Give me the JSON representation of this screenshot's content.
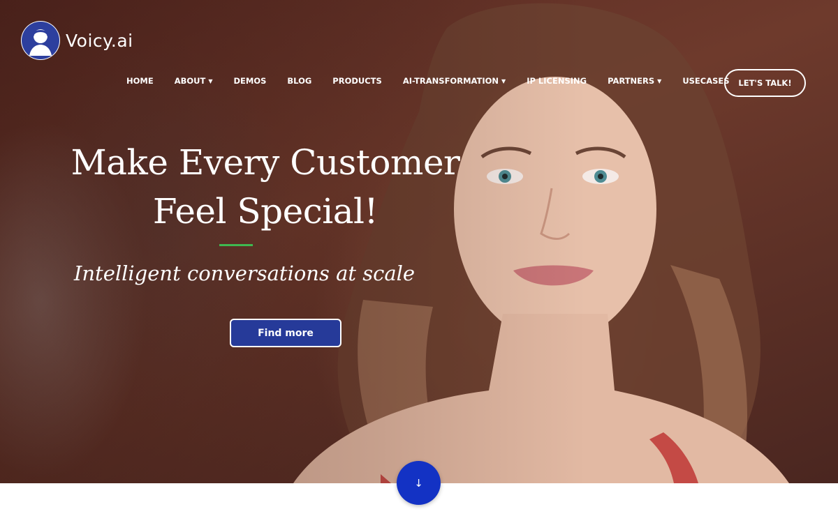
{
  "header": {
    "brand": "Voicy.ai",
    "cta_label": "LET'S TALK!"
  },
  "nav": {
    "items": [
      {
        "label": "HOME",
        "has_dropdown": false
      },
      {
        "label": "ABOUT",
        "has_dropdown": true
      },
      {
        "label": "DEMOS",
        "has_dropdown": false
      },
      {
        "label": "BLOG",
        "has_dropdown": false
      },
      {
        "label": "PRODUCTS",
        "has_dropdown": false
      },
      {
        "label": "AI-TRANSFORMATION",
        "has_dropdown": true
      },
      {
        "label": "IP LICENSING",
        "has_dropdown": false
      },
      {
        "label": "PARTNERS",
        "has_dropdown": true
      },
      {
        "label": "USECASES",
        "has_dropdown": false
      }
    ],
    "dropdown_icon": "chevron-down-icon"
  },
  "hero": {
    "headline_line1": "Make Every Customer",
    "headline_line2": "Feel Special!",
    "tagline": "Intelligent conversations at scale",
    "button_label": "Find more",
    "scroll_icon": "↓"
  },
  "colors": {
    "accent_green": "#3fb950",
    "button_blue": "#263a99",
    "scroll_blue": "#1332c4"
  }
}
